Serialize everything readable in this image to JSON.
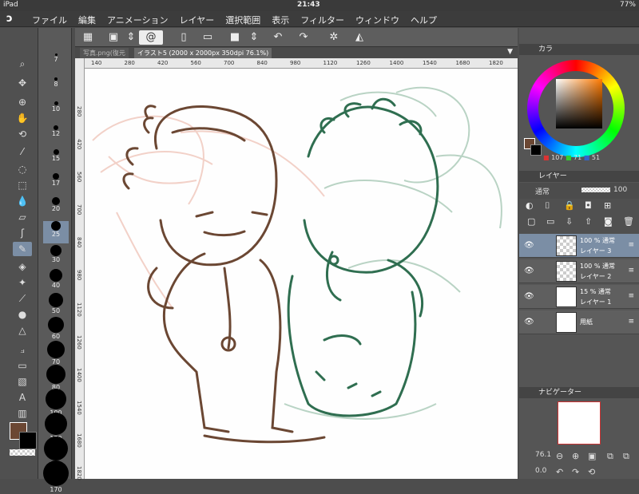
{
  "statusbar": {
    "device": "iPad",
    "time": "21:43",
    "battery": "77%"
  },
  "menu": {
    "items": [
      "ファイル",
      "編集",
      "アニメーション",
      "レイヤー",
      "選択範囲",
      "表示",
      "フィルター",
      "ウィンドウ",
      "ヘルプ"
    ]
  },
  "tabs": [
    {
      "label": "写真.png(復元"
    },
    {
      "label": "イラスト5 (2000 x 2000px 350dpi 76.1%)"
    }
  ],
  "ruler_top": [
    "140",
    "280",
    "420",
    "560",
    "700",
    "840",
    "980",
    "1120",
    "1260",
    "1400",
    "1540",
    "1680",
    "1820"
  ],
  "ruler_left": [
    "280",
    "420",
    "560",
    "700",
    "840",
    "980",
    "1120",
    "1260",
    "1400",
    "1540",
    "1680",
    "1820"
  ],
  "brushes": [
    "7",
    "8",
    "10",
    "12",
    "15",
    "17",
    "20",
    "25",
    "30",
    "40",
    "50",
    "60",
    "70",
    "80",
    "100",
    "120",
    "150",
    "170"
  ],
  "color_panel": {
    "title": "カラ",
    "r": "107",
    "g": "71",
    "b": "51",
    "main_color": "#6b4733",
    "sub_color": "#000000"
  },
  "layer_panel": {
    "title": "レイヤー",
    "blend_mode": "通常",
    "opacity": "100",
    "layers": [
      {
        "percent": "100 % 通常",
        "name": "レイヤー 3",
        "selected": true,
        "thumb": "check"
      },
      {
        "percent": "100 % 通常",
        "name": "レイヤー 2",
        "selected": false,
        "thumb": "check"
      },
      {
        "percent": "15 % 通常",
        "name": "レイヤー 1",
        "selected": false,
        "thumb": "photo"
      },
      {
        "percent": "",
        "name": "用紙",
        "selected": false,
        "thumb": "white"
      }
    ]
  },
  "navigator": {
    "title": "ナビゲーター",
    "zoom": "76.1",
    "angle": "0.0"
  }
}
